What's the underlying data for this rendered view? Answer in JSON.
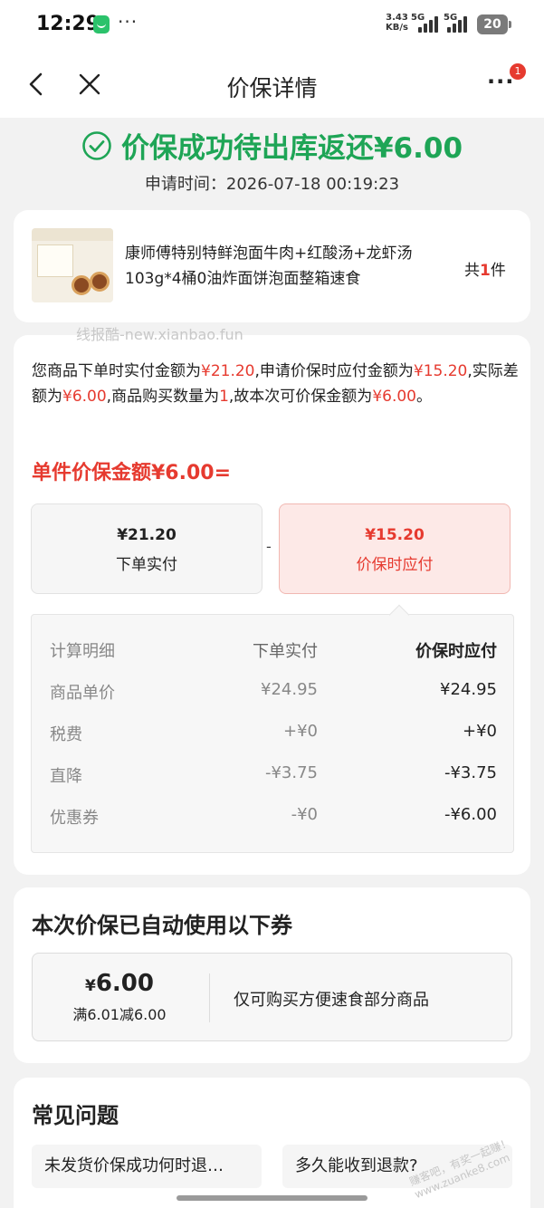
{
  "status_bar": {
    "time": "12:29",
    "more": "···",
    "net_speed_top": "3.43",
    "net_speed_unit": "KB/s",
    "network_1": "5G",
    "network_2": "5G",
    "battery": "20"
  },
  "nav": {
    "title": "价保详情",
    "more": "···",
    "badge": "1"
  },
  "hero": {
    "status": "价保成功待出库返还¥6.00",
    "apply_time": "申请时间：2026-07-18 00:19:23"
  },
  "product": {
    "name": "康师傅特别特鲜泡面牛肉+红酸汤+龙虾汤103g*4桶0油炸面饼泡面整箱速食",
    "qty_prefix": "共",
    "qty": "1",
    "qty_suffix": "件"
  },
  "watermark": "线报酷-new.xianbao.fun",
  "calc": {
    "s1": "您商品下单时实付金额为",
    "v1": "¥21.20",
    "s2": ",申请价保时应付金额为",
    "v2": "¥15.20",
    "s3": ",实际差额为",
    "v3": "¥6.00",
    "s4": ",商品购买数量为",
    "v4": "1",
    "s5": ",故本次可价保金额为",
    "v5": "¥6.00",
    "s6": "。",
    "unit_title": "单件价保金额¥6.00=",
    "left_amount": "¥21.20",
    "left_label": "下单实付",
    "minus": "-",
    "right_amount": "¥15.20",
    "right_label": "价保时应付"
  },
  "detail": {
    "header": [
      "计算明细",
      "下单实付",
      "价保时应付"
    ],
    "rows": [
      [
        "商品单价",
        "¥24.95",
        "¥24.95"
      ],
      [
        "税费",
        "+¥0",
        "+¥0"
      ],
      [
        "直降",
        "-¥3.75",
        "-¥3.75"
      ],
      [
        "优惠券",
        "-¥0",
        "-¥6.00"
      ]
    ]
  },
  "coupon": {
    "title": "本次价保已自动使用以下券",
    "currency": "¥",
    "amount": "6.00",
    "condition": "满6.01减6.00",
    "description": "仅可购买方便速食部分商品"
  },
  "faq": {
    "title": "常见问题",
    "items": [
      "未发货价保成功何时退…",
      "多久能收到退款?"
    ]
  },
  "watermark2": "赚客吧，有奖一起赚！www.zuanke8.com",
  "colors": {
    "success_green": "#1ea556",
    "price_red": "#e63a2f"
  }
}
